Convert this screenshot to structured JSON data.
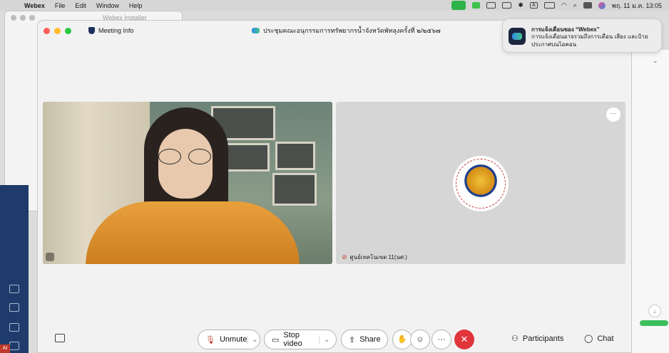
{
  "menubar": {
    "app_name": "Webex",
    "menus": [
      "File",
      "Edit",
      "Window",
      "Help"
    ],
    "clock": "พฤ. 11 ม.ค.  13:05",
    "tray_text": "A"
  },
  "installer_window": {
    "title": "Webex Installer"
  },
  "meeting": {
    "info_label": "Meeting Info",
    "title": "ประชุมคณะอนุกรรมการทรัพยากรน้ำจังหวัดพัทลุงครั้งที่ ๒/๒๕๖๗"
  },
  "participants_tiles": [
    {
      "type": "video"
    },
    {
      "type": "avatar",
      "name": "ศูนย์เทคโนเขต 11(นศ.)",
      "more": "···"
    }
  ],
  "controls": {
    "unmute_label": "Unmute",
    "stop_video_label": "Stop video",
    "share_label": "Share",
    "more_label": "···",
    "participants_label": "Participants",
    "chat_label": "Chat"
  },
  "notification": {
    "title": "การแจ้งเตือนของ “Webex”",
    "body": "การแจ้งเตือนอาจรวมถึงการเตือน เสียง และป้ายประกาศบนไอคอน"
  },
  "left_strip": {
    "badge": "AI"
  },
  "colors": {
    "end_call": "#e0353b",
    "menubar_green": "#2db34a",
    "accent_blue": "#1d2f5c"
  }
}
